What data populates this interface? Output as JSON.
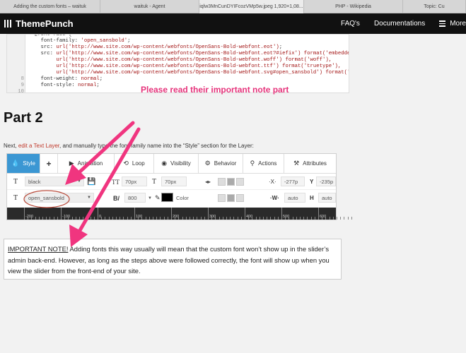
{
  "browser": {
    "tabs": [
      "Adding the custom fonts – waituk",
      "waituk - Agent",
      "iqlw3MnCunDYIFcozVMp5w.jpeg 1,920×1,08...",
      "PHP - Wikipedia",
      "Topic: Cu"
    ]
  },
  "header": {
    "logo": "ThemePunch",
    "nav": [
      "FAQ's",
      "Documentations",
      "More"
    ]
  },
  "code": {
    "lines": [
      {
        "n": "",
        "parts": [
          {
            "t": "  @font-face {",
            "c": "k"
          }
        ]
      },
      {
        "n": "",
        "parts": [
          {
            "t": "    font-family: ",
            "c": "k"
          },
          {
            "t": "'open_sansbold'",
            "c": "s"
          },
          {
            "t": ";",
            "c": "k"
          }
        ]
      },
      {
        "n": "",
        "parts": [
          {
            "t": "    src: ",
            "c": "k"
          },
          {
            "t": "url('http://www.site.com/wp-content/webfonts/OpenSans-Bold-webfont.eot')",
            "c": "s"
          },
          {
            "t": ";",
            "c": "k"
          }
        ]
      },
      {
        "n": "",
        "parts": [
          {
            "t": "    src: ",
            "c": "k"
          },
          {
            "t": "url('http://www.site.com/wp-content/webfonts/OpenSans-Bold-webfont.eot?#iefix')",
            "c": "s"
          },
          {
            "t": " format('embedded",
            "c": "s"
          }
        ]
      },
      {
        "n": "",
        "parts": [
          {
            "t": "         url('http://www.site.com/wp-content/webfonts/OpenSans-Bold-webfont.woff')",
            "c": "s"
          },
          {
            "t": " format('woff'),",
            "c": "s"
          }
        ]
      },
      {
        "n": "",
        "parts": [
          {
            "t": "         url('http://www.site.com/wp-content/webfonts/OpenSans-Bold-webfont.ttf')",
            "c": "s"
          },
          {
            "t": " format('truetype'),",
            "c": "s"
          }
        ]
      },
      {
        "n": "",
        "parts": [
          {
            "t": "         url('http://www.site.com/wp-content/webfonts/OpenSans-Bold-webfont.svg#open_sansbold')",
            "c": "s"
          },
          {
            "t": " format('s",
            "c": "s"
          }
        ]
      },
      {
        "n": "8",
        "parts": [
          {
            "t": "    font-weight: ",
            "c": "k"
          },
          {
            "t": "normal",
            "c": "v"
          },
          {
            "t": ";",
            "c": "k"
          }
        ]
      },
      {
        "n": "9",
        "parts": [
          {
            "t": "    font-style: ",
            "c": "k"
          },
          {
            "t": "normal",
            "c": "v"
          },
          {
            "t": ";",
            "c": "k"
          }
        ]
      },
      {
        "n": "10",
        "parts": []
      },
      {
        "n": "11",
        "parts": [
          {
            "t": "  }",
            "c": "k"
          }
        ]
      }
    ]
  },
  "article": {
    "heading": "Part 2",
    "para_before": "Next, ",
    "para_link": "edit a Text Layer",
    "para_after": ", and manually type the font-family name into the “Style” section for the Layer:",
    "annotation": "Please read their important note part",
    "note_label": "IMPORTANT NOTE!",
    "note_text": " Adding fonts this way usually will mean that the custom font won’t show up in the slider’s admin back-end. However, as long as the steps above were followed correctly, the font will show up when you view the slider from the front-end of your site."
  },
  "editor": {
    "tabs": [
      {
        "label": "Style",
        "icon": "💧"
      },
      {
        "label": "",
        "icon": "+"
      },
      {
        "label": "Animation",
        "icon": "▶"
      },
      {
        "label": "Loop",
        "icon": "⟲"
      },
      {
        "label": "Visibility",
        "icon": "◉"
      },
      {
        "label": "Behavior",
        "icon": "⚙"
      },
      {
        "label": "Actions",
        "icon": "⚲"
      },
      {
        "label": "Attributes",
        "icon": "⚒"
      }
    ],
    "row1": {
      "style_select": "black",
      "font_size": "70px",
      "line_height": "70px",
      "x": "-277p",
      "y": "-235p"
    },
    "row2": {
      "font_family": "open_sansbold",
      "weight": "800",
      "color_label": "Color",
      "w": "auto",
      "h": "auto"
    },
    "ruler": [
      "-200",
      "-100",
      "0",
      "100",
      "200",
      "300",
      "400",
      "500",
      "600"
    ]
  },
  "colors": {
    "accent": "#3b97d3",
    "annotation": "#e6337b"
  }
}
